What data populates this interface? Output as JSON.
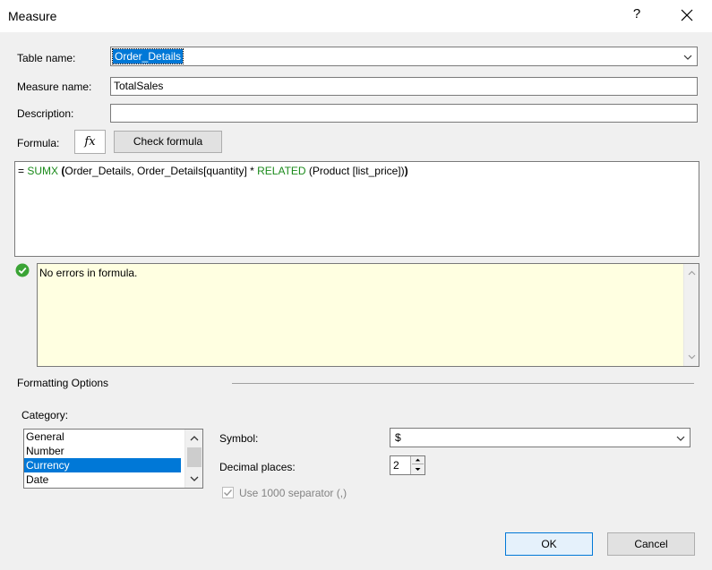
{
  "window": {
    "title": "Measure",
    "help_label": "?"
  },
  "fields": {
    "table_name_label": "Table name:",
    "table_name_value": "Order_Details",
    "measure_name_label": "Measure name:",
    "measure_name_value": "TotalSales",
    "description_label": "Description:",
    "description_value": "",
    "formula_label": "Formula:"
  },
  "buttons": {
    "fx_label": "fx",
    "check_formula": "Check formula",
    "ok": "OK",
    "cancel": "Cancel"
  },
  "formula": {
    "tokens": [
      {
        "text": "= ",
        "style": "plain"
      },
      {
        "text": "SUMX ",
        "style": "keyword"
      },
      {
        "text": "(",
        "style": "bold"
      },
      {
        "text": "Order_Details, Order_Details[quantity] * ",
        "style": "plain"
      },
      {
        "text": "RELATED ",
        "style": "keyword"
      },
      {
        "text": "(Product [list_price])",
        "style": "plain"
      },
      {
        "text": ")",
        "style": "bold"
      }
    ]
  },
  "status": {
    "message": "No errors in formula.",
    "icon": "check-circle-icon",
    "color": "#3aa335"
  },
  "formatting": {
    "section_label": "Formatting Options",
    "category_label": "Category:",
    "categories": [
      "General",
      "Number",
      "Currency",
      "Date"
    ],
    "selected_category": "Currency",
    "symbol_label": "Symbol:",
    "symbol_value": "$",
    "decimal_label": "Decimal places:",
    "decimal_value": "2",
    "separator_label": "Use 1000 separator (,)",
    "separator_checked": true
  },
  "colors": {
    "accent": "#0078d7",
    "keyword": "#1a8a1a",
    "message_bg": "#ffffe1"
  }
}
